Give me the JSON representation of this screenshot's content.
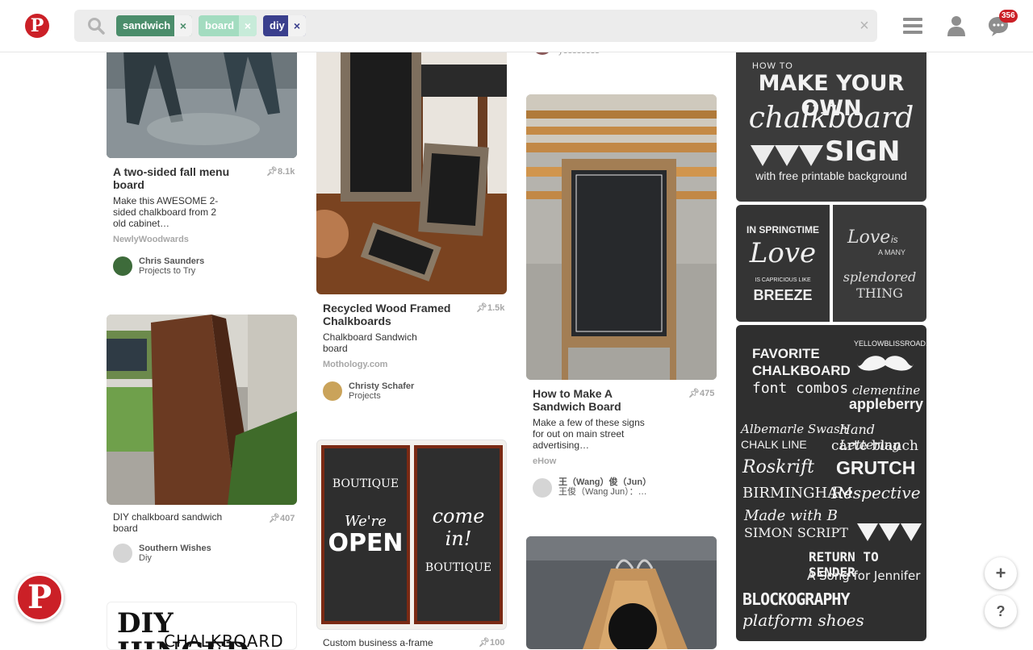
{
  "header": {
    "logo_letter": "P",
    "search_tags": [
      {
        "label": "sandwich",
        "color": "#4b8d6b"
      },
      {
        "label": "board",
        "color": "#a3dcc0"
      },
      {
        "label": "diy",
        "color": "#3a3f8d"
      }
    ],
    "chip_remove": "×",
    "clear_label": "×",
    "notifications_count": "356"
  },
  "pins": {
    "p1": {
      "title": "A two-sided fall menu board",
      "count": "8.1k",
      "desc": "Make this AWESOME 2-sided chalkboard from 2 old cabinet…",
      "source": "NewlyWoodwards",
      "user": "Chris Saunders",
      "board": "Projects to Try"
    },
    "p2": {
      "title": "",
      "count": "407",
      "desc": "DIY chalkboard sandwich board",
      "source": "",
      "user": "Southern Wishes",
      "board": "Diy"
    },
    "p3": {
      "image_text_1": "DIY HINGED",
      "image_text_2": "CHALKBOARD"
    },
    "p4": {
      "title": "Recycled Wood Framed Chalkboards",
      "count": "1.5k",
      "desc": "Chalkboard Sandwich board",
      "source": "Mothology.com",
      "user": "Christy Schafer",
      "board": "Projects"
    },
    "p5": {
      "image_left": [
        "BOUTIQUE",
        "We're",
        "OPEN"
      ],
      "image_right": [
        "come",
        "in!",
        "BOUTIQUE"
      ],
      "title": "Custom business a-frame",
      "count": "100"
    },
    "p6": {
      "user_partial": "yessssess"
    },
    "p7": {
      "title": "How to Make A Sandwich Board",
      "count": "475",
      "desc": "Make a few of these signs for out on main street advertising…",
      "source": "eHow",
      "user": "王（Wang）俊（Jun）",
      "board": "王俊（Wang Jun）：…"
    },
    "p9": {
      "line1": "HOW TO",
      "line2": "MAKE YOUR OWN",
      "line3": "chalkboard",
      "line4": "SIGN",
      "line5": "with free printable background"
    },
    "p10": {
      "left": [
        "IN SPRINGTIME",
        "Love",
        "IS CAPRICIOUS LIKE",
        "BREEZE"
      ],
      "right": [
        "Love",
        "is",
        "A MANY",
        "splendored",
        "THING"
      ]
    },
    "p11": {
      "lines": [
        "FAVORITE",
        "CHALKBOARD",
        "font combos",
        "YELLOWBLISSROAD.COM",
        "clementine",
        "appleberry",
        "Albemarle Swash",
        "Hand Lettering",
        "CHALK LINE",
        "carte blanch",
        "Roskrift",
        "GRUTCH",
        "BIRMINGHAM",
        "Respective",
        "Made with B",
        "SIMON SCRIPT",
        "RETURN TO SENDER",
        "A Song for Jennifer",
        "BLOCKOGRAPHY",
        "platform shoes"
      ]
    }
  },
  "fab": {
    "add": "+",
    "help": "?"
  },
  "colors": {
    "brand": "#cb2027",
    "chalk": "#3b3b3b"
  }
}
